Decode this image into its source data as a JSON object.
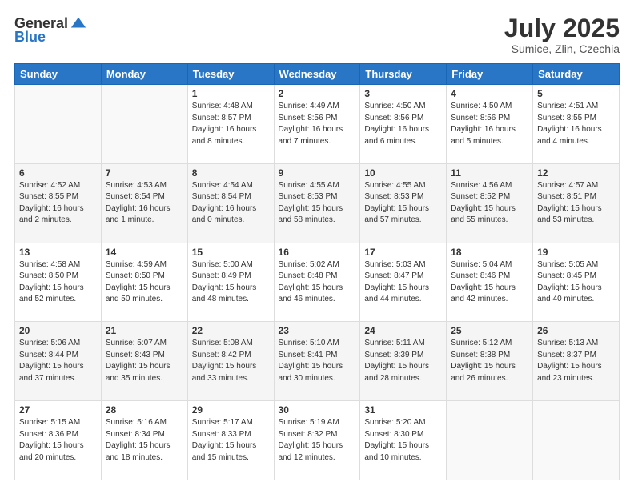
{
  "logo": {
    "general": "General",
    "blue": "Blue"
  },
  "header": {
    "month": "July 2025",
    "location": "Sumice, Zlin, Czechia"
  },
  "weekdays": [
    "Sunday",
    "Monday",
    "Tuesday",
    "Wednesday",
    "Thursday",
    "Friday",
    "Saturday"
  ],
  "weeks": [
    [
      {
        "day": "",
        "info": ""
      },
      {
        "day": "",
        "info": ""
      },
      {
        "day": "1",
        "info": "Sunrise: 4:48 AM\nSunset: 8:57 PM\nDaylight: 16 hours and 8 minutes."
      },
      {
        "day": "2",
        "info": "Sunrise: 4:49 AM\nSunset: 8:56 PM\nDaylight: 16 hours and 7 minutes."
      },
      {
        "day": "3",
        "info": "Sunrise: 4:50 AM\nSunset: 8:56 PM\nDaylight: 16 hours and 6 minutes."
      },
      {
        "day": "4",
        "info": "Sunrise: 4:50 AM\nSunset: 8:56 PM\nDaylight: 16 hours and 5 minutes."
      },
      {
        "day": "5",
        "info": "Sunrise: 4:51 AM\nSunset: 8:55 PM\nDaylight: 16 hours and 4 minutes."
      }
    ],
    [
      {
        "day": "6",
        "info": "Sunrise: 4:52 AM\nSunset: 8:55 PM\nDaylight: 16 hours and 2 minutes."
      },
      {
        "day": "7",
        "info": "Sunrise: 4:53 AM\nSunset: 8:54 PM\nDaylight: 16 hours and 1 minute."
      },
      {
        "day": "8",
        "info": "Sunrise: 4:54 AM\nSunset: 8:54 PM\nDaylight: 16 hours and 0 minutes."
      },
      {
        "day": "9",
        "info": "Sunrise: 4:55 AM\nSunset: 8:53 PM\nDaylight: 15 hours and 58 minutes."
      },
      {
        "day": "10",
        "info": "Sunrise: 4:55 AM\nSunset: 8:53 PM\nDaylight: 15 hours and 57 minutes."
      },
      {
        "day": "11",
        "info": "Sunrise: 4:56 AM\nSunset: 8:52 PM\nDaylight: 15 hours and 55 minutes."
      },
      {
        "day": "12",
        "info": "Sunrise: 4:57 AM\nSunset: 8:51 PM\nDaylight: 15 hours and 53 minutes."
      }
    ],
    [
      {
        "day": "13",
        "info": "Sunrise: 4:58 AM\nSunset: 8:50 PM\nDaylight: 15 hours and 52 minutes."
      },
      {
        "day": "14",
        "info": "Sunrise: 4:59 AM\nSunset: 8:50 PM\nDaylight: 15 hours and 50 minutes."
      },
      {
        "day": "15",
        "info": "Sunrise: 5:00 AM\nSunset: 8:49 PM\nDaylight: 15 hours and 48 minutes."
      },
      {
        "day": "16",
        "info": "Sunrise: 5:02 AM\nSunset: 8:48 PM\nDaylight: 15 hours and 46 minutes."
      },
      {
        "day": "17",
        "info": "Sunrise: 5:03 AM\nSunset: 8:47 PM\nDaylight: 15 hours and 44 minutes."
      },
      {
        "day": "18",
        "info": "Sunrise: 5:04 AM\nSunset: 8:46 PM\nDaylight: 15 hours and 42 minutes."
      },
      {
        "day": "19",
        "info": "Sunrise: 5:05 AM\nSunset: 8:45 PM\nDaylight: 15 hours and 40 minutes."
      }
    ],
    [
      {
        "day": "20",
        "info": "Sunrise: 5:06 AM\nSunset: 8:44 PM\nDaylight: 15 hours and 37 minutes."
      },
      {
        "day": "21",
        "info": "Sunrise: 5:07 AM\nSunset: 8:43 PM\nDaylight: 15 hours and 35 minutes."
      },
      {
        "day": "22",
        "info": "Sunrise: 5:08 AM\nSunset: 8:42 PM\nDaylight: 15 hours and 33 minutes."
      },
      {
        "day": "23",
        "info": "Sunrise: 5:10 AM\nSunset: 8:41 PM\nDaylight: 15 hours and 30 minutes."
      },
      {
        "day": "24",
        "info": "Sunrise: 5:11 AM\nSunset: 8:39 PM\nDaylight: 15 hours and 28 minutes."
      },
      {
        "day": "25",
        "info": "Sunrise: 5:12 AM\nSunset: 8:38 PM\nDaylight: 15 hours and 26 minutes."
      },
      {
        "day": "26",
        "info": "Sunrise: 5:13 AM\nSunset: 8:37 PM\nDaylight: 15 hours and 23 minutes."
      }
    ],
    [
      {
        "day": "27",
        "info": "Sunrise: 5:15 AM\nSunset: 8:36 PM\nDaylight: 15 hours and 20 minutes."
      },
      {
        "day": "28",
        "info": "Sunrise: 5:16 AM\nSunset: 8:34 PM\nDaylight: 15 hours and 18 minutes."
      },
      {
        "day": "29",
        "info": "Sunrise: 5:17 AM\nSunset: 8:33 PM\nDaylight: 15 hours and 15 minutes."
      },
      {
        "day": "30",
        "info": "Sunrise: 5:19 AM\nSunset: 8:32 PM\nDaylight: 15 hours and 12 minutes."
      },
      {
        "day": "31",
        "info": "Sunrise: 5:20 AM\nSunset: 8:30 PM\nDaylight: 15 hours and 10 minutes."
      },
      {
        "day": "",
        "info": ""
      },
      {
        "day": "",
        "info": ""
      }
    ]
  ]
}
